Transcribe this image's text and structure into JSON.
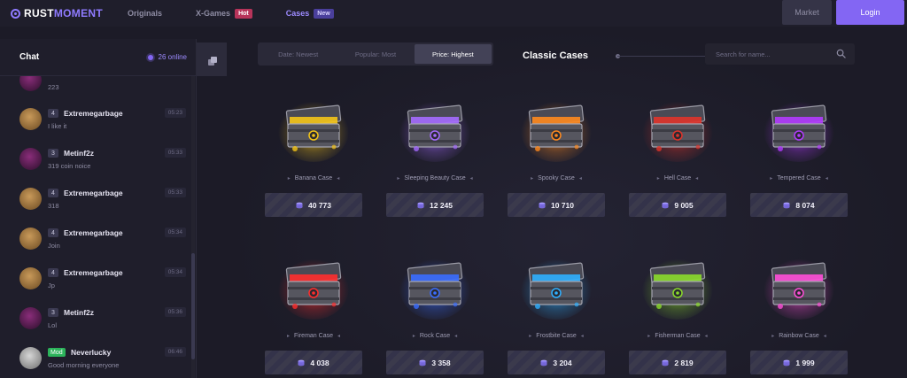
{
  "header": {
    "logo_white": "RUST",
    "logo_purple": "MOMENT",
    "nav": [
      {
        "label": "Originals",
        "badge": ""
      },
      {
        "label": "X-Games",
        "badge": "Hot"
      },
      {
        "label": "Cases",
        "badge": "New"
      }
    ],
    "market_label": "Market",
    "login_label": "Login"
  },
  "chat": {
    "title": "Chat",
    "online": "26 online",
    "messages": [
      {
        "level": "",
        "user": "",
        "text": "223",
        "time": "",
        "avatar": "dark"
      },
      {
        "level": "4",
        "user": "Extremegarbage",
        "text": "I like it",
        "time": "05:23",
        "avatar": "brown"
      },
      {
        "level": "3",
        "user": "Metinf2z",
        "text": "319 coin noice",
        "time": "05:33",
        "avatar": "dark"
      },
      {
        "level": "4",
        "user": "Extremegarbage",
        "text": "318",
        "time": "05:33",
        "avatar": "brown"
      },
      {
        "level": "4",
        "user": "Extremegarbage",
        "text": "Join",
        "time": "05:34",
        "avatar": "brown"
      },
      {
        "level": "4",
        "user": "Extremegarbage",
        "text": "Jp",
        "time": "05:34",
        "avatar": "brown"
      },
      {
        "level": "3",
        "user": "Metinf2z",
        "text": "Lol",
        "time": "05:36",
        "avatar": "dark"
      },
      {
        "level": "Mod",
        "user": "Neverlucky",
        "text": "Good morning everyone",
        "time": "06:46",
        "avatar": "grey"
      }
    ]
  },
  "filters": [
    {
      "label": "Date: Newest",
      "active": false
    },
    {
      "label": "Popular: Most",
      "active": false
    },
    {
      "label": "Price: Highest",
      "active": true
    }
  ],
  "section_title": "Classic Cases",
  "search": {
    "placeholder": "Search for name..."
  },
  "cases": [
    {
      "name": "Banana Case",
      "price": "40 773",
      "color": "#f5c518",
      "icon": "banana-case-icon"
    },
    {
      "name": "Sleeping Beauty Case",
      "price": "12 245",
      "color": "#a56bff",
      "icon": "sleeping-beauty-case-icon"
    },
    {
      "name": "Spooky Case",
      "price": "10 710",
      "color": "#ff8a1e",
      "icon": "spooky-case-icon"
    },
    {
      "name": "Hell Case",
      "price": "9 005",
      "color": "#e0342b",
      "icon": "hell-case-icon"
    },
    {
      "name": "Tempered Case",
      "price": "8 074",
      "color": "#b23bff",
      "icon": "tempered-case-icon"
    },
    {
      "name": "Fireman Case",
      "price": "4 038",
      "color": "#ff2d2d",
      "icon": "fireman-case-icon"
    },
    {
      "name": "Rock Case",
      "price": "3 358",
      "color": "#3a6dff",
      "icon": "rock-case-icon"
    },
    {
      "name": "Frostbite Case",
      "price": "3 204",
      "color": "#2fb0ff",
      "icon": "frostbite-case-icon"
    },
    {
      "name": "Fisherman Case",
      "price": "2 819",
      "color": "#8bdc2b",
      "icon": "fisherman-case-icon"
    },
    {
      "name": "Rainbow Case",
      "price": "1 999",
      "color": "#ff4fd8",
      "icon": "rainbow-case-icon"
    }
  ]
}
